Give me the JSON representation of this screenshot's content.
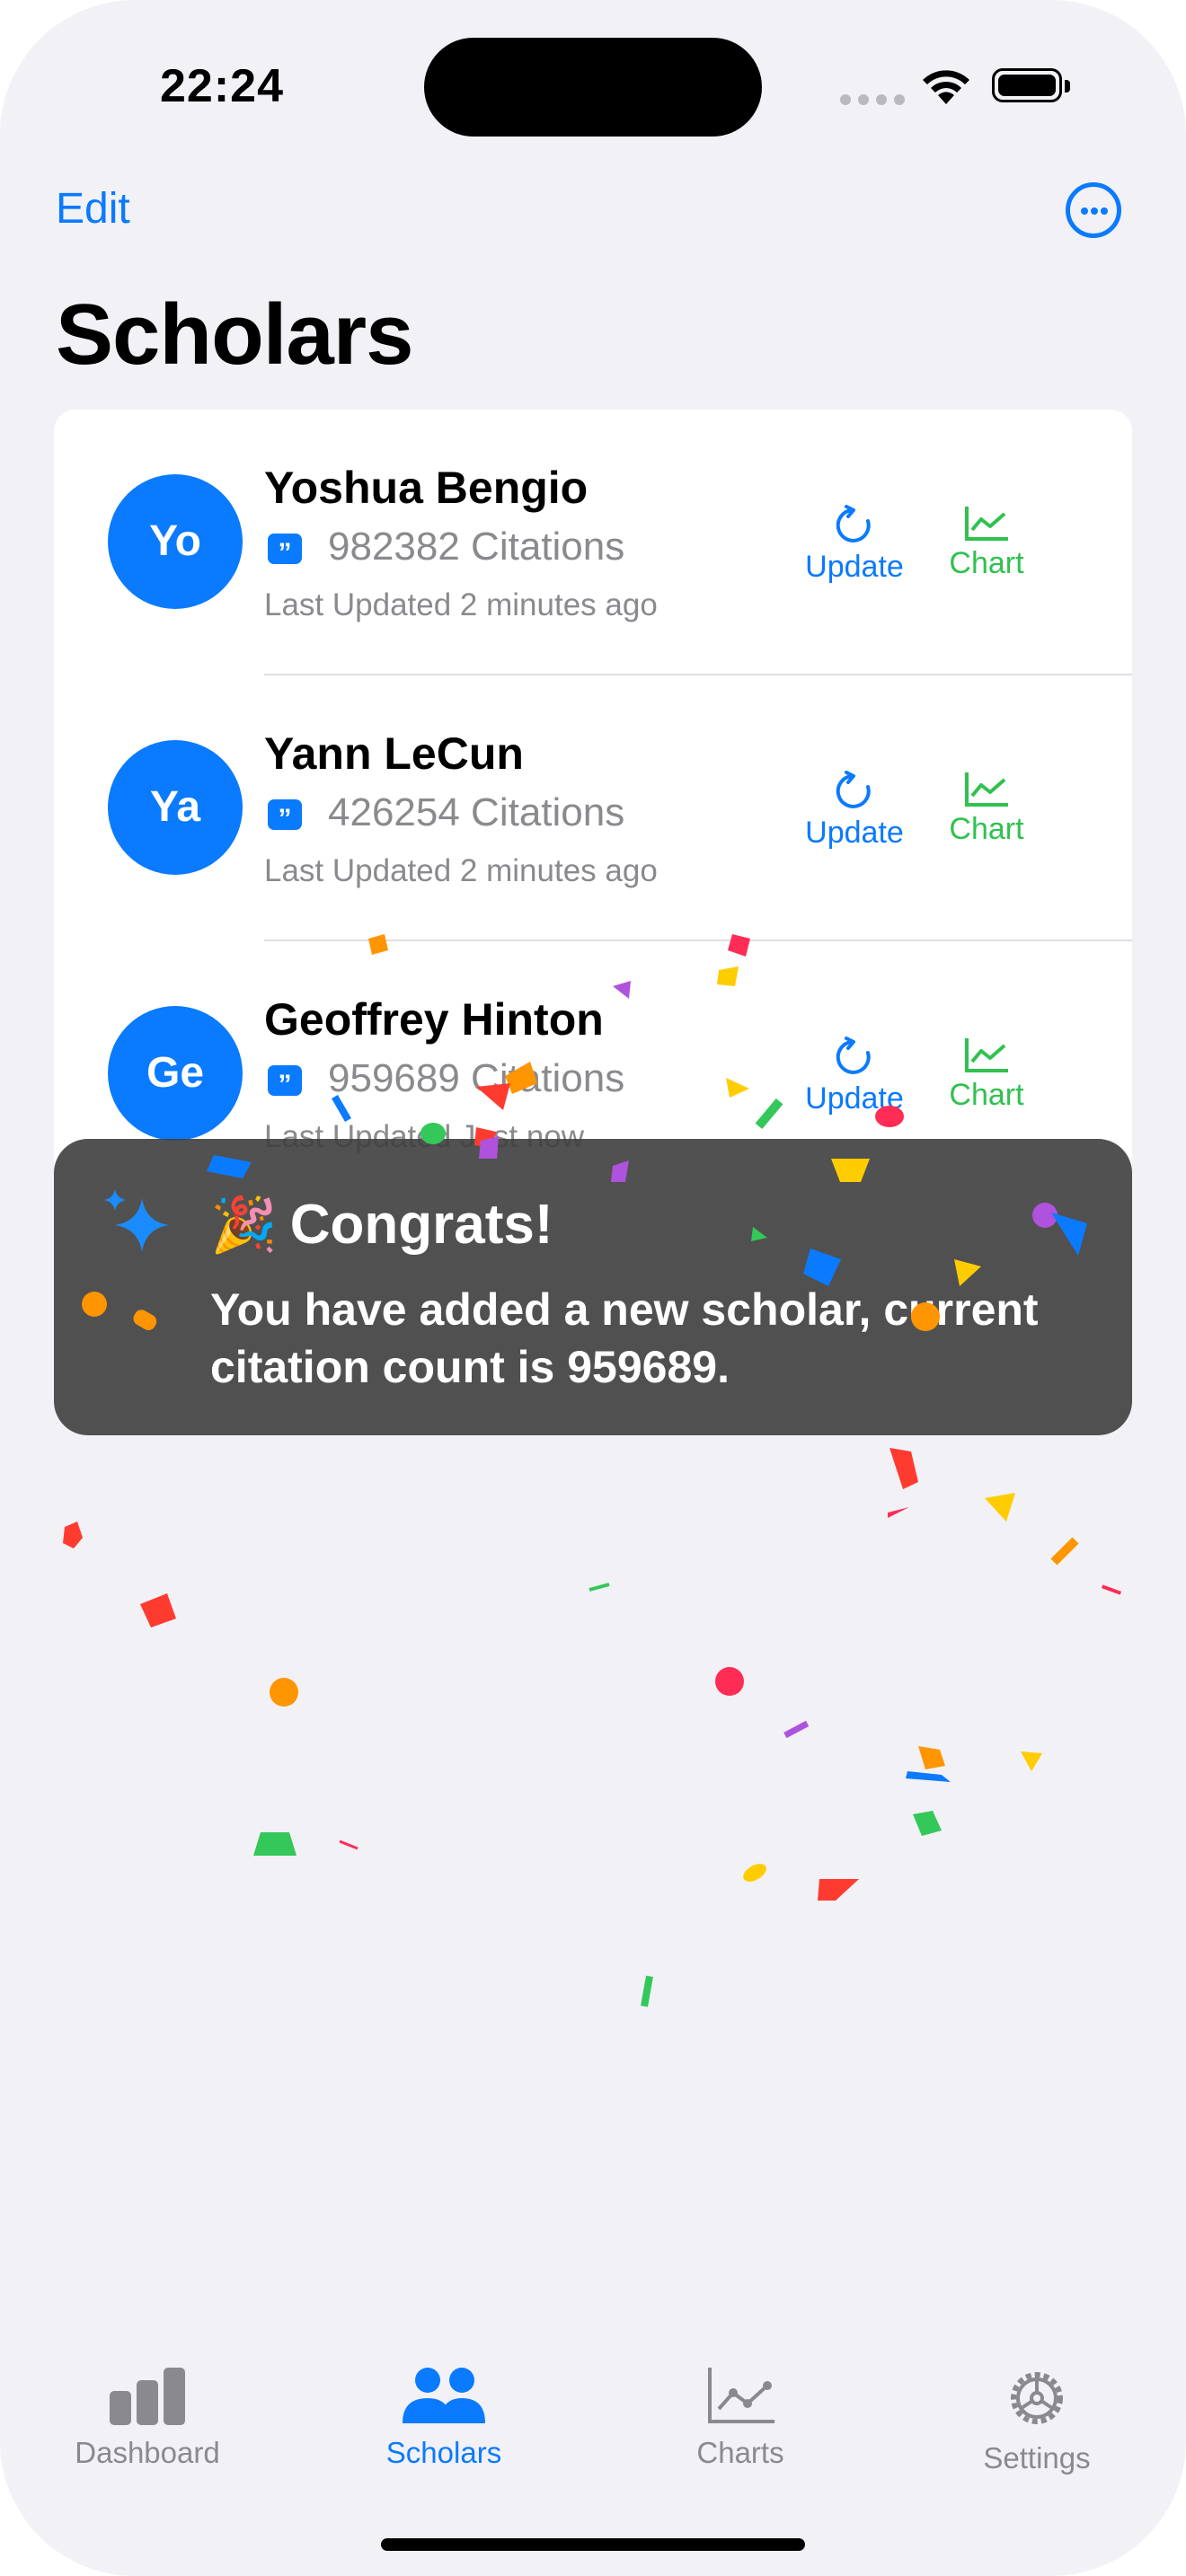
{
  "status_bar": {
    "time": "22:24"
  },
  "nav": {
    "edit_label": "Edit",
    "more_icon": "ellipsis-circle-icon",
    "title": "Scholars"
  },
  "scholars": [
    {
      "initials": "Yo",
      "name": "Yoshua Bengio",
      "citations": "982382 Citations",
      "updated": "Last Updated 2 minutes ago",
      "update_label": "Update",
      "chart_label": "Chart"
    },
    {
      "initials": "Ya",
      "name": "Yann LeCun",
      "citations": "426254 Citations",
      "updated": "Last Updated 2 minutes ago",
      "update_label": "Update",
      "chart_label": "Chart"
    },
    {
      "initials": "Ge",
      "name": "Geoffrey Hinton",
      "citations": "959689 Citations",
      "updated": "Last Updated Just now",
      "update_label": "Update",
      "chart_label": "Chart"
    }
  ],
  "toast": {
    "emoji": "🎉",
    "title": "Congrats!",
    "message": "You have added a new scholar, current citation count is 959689."
  },
  "tabs": [
    {
      "label": "Dashboard",
      "icon": "chart-bar-icon",
      "active": false
    },
    {
      "label": "Scholars",
      "icon": "people-icon",
      "active": true
    },
    {
      "label": "Charts",
      "icon": "line-chart-icon",
      "active": false
    },
    {
      "label": "Settings",
      "icon": "gear-icon",
      "active": false
    }
  ],
  "colors": {
    "accent": "#0a7aff",
    "chart_green": "#30c14f",
    "background": "#f2f1f6"
  }
}
